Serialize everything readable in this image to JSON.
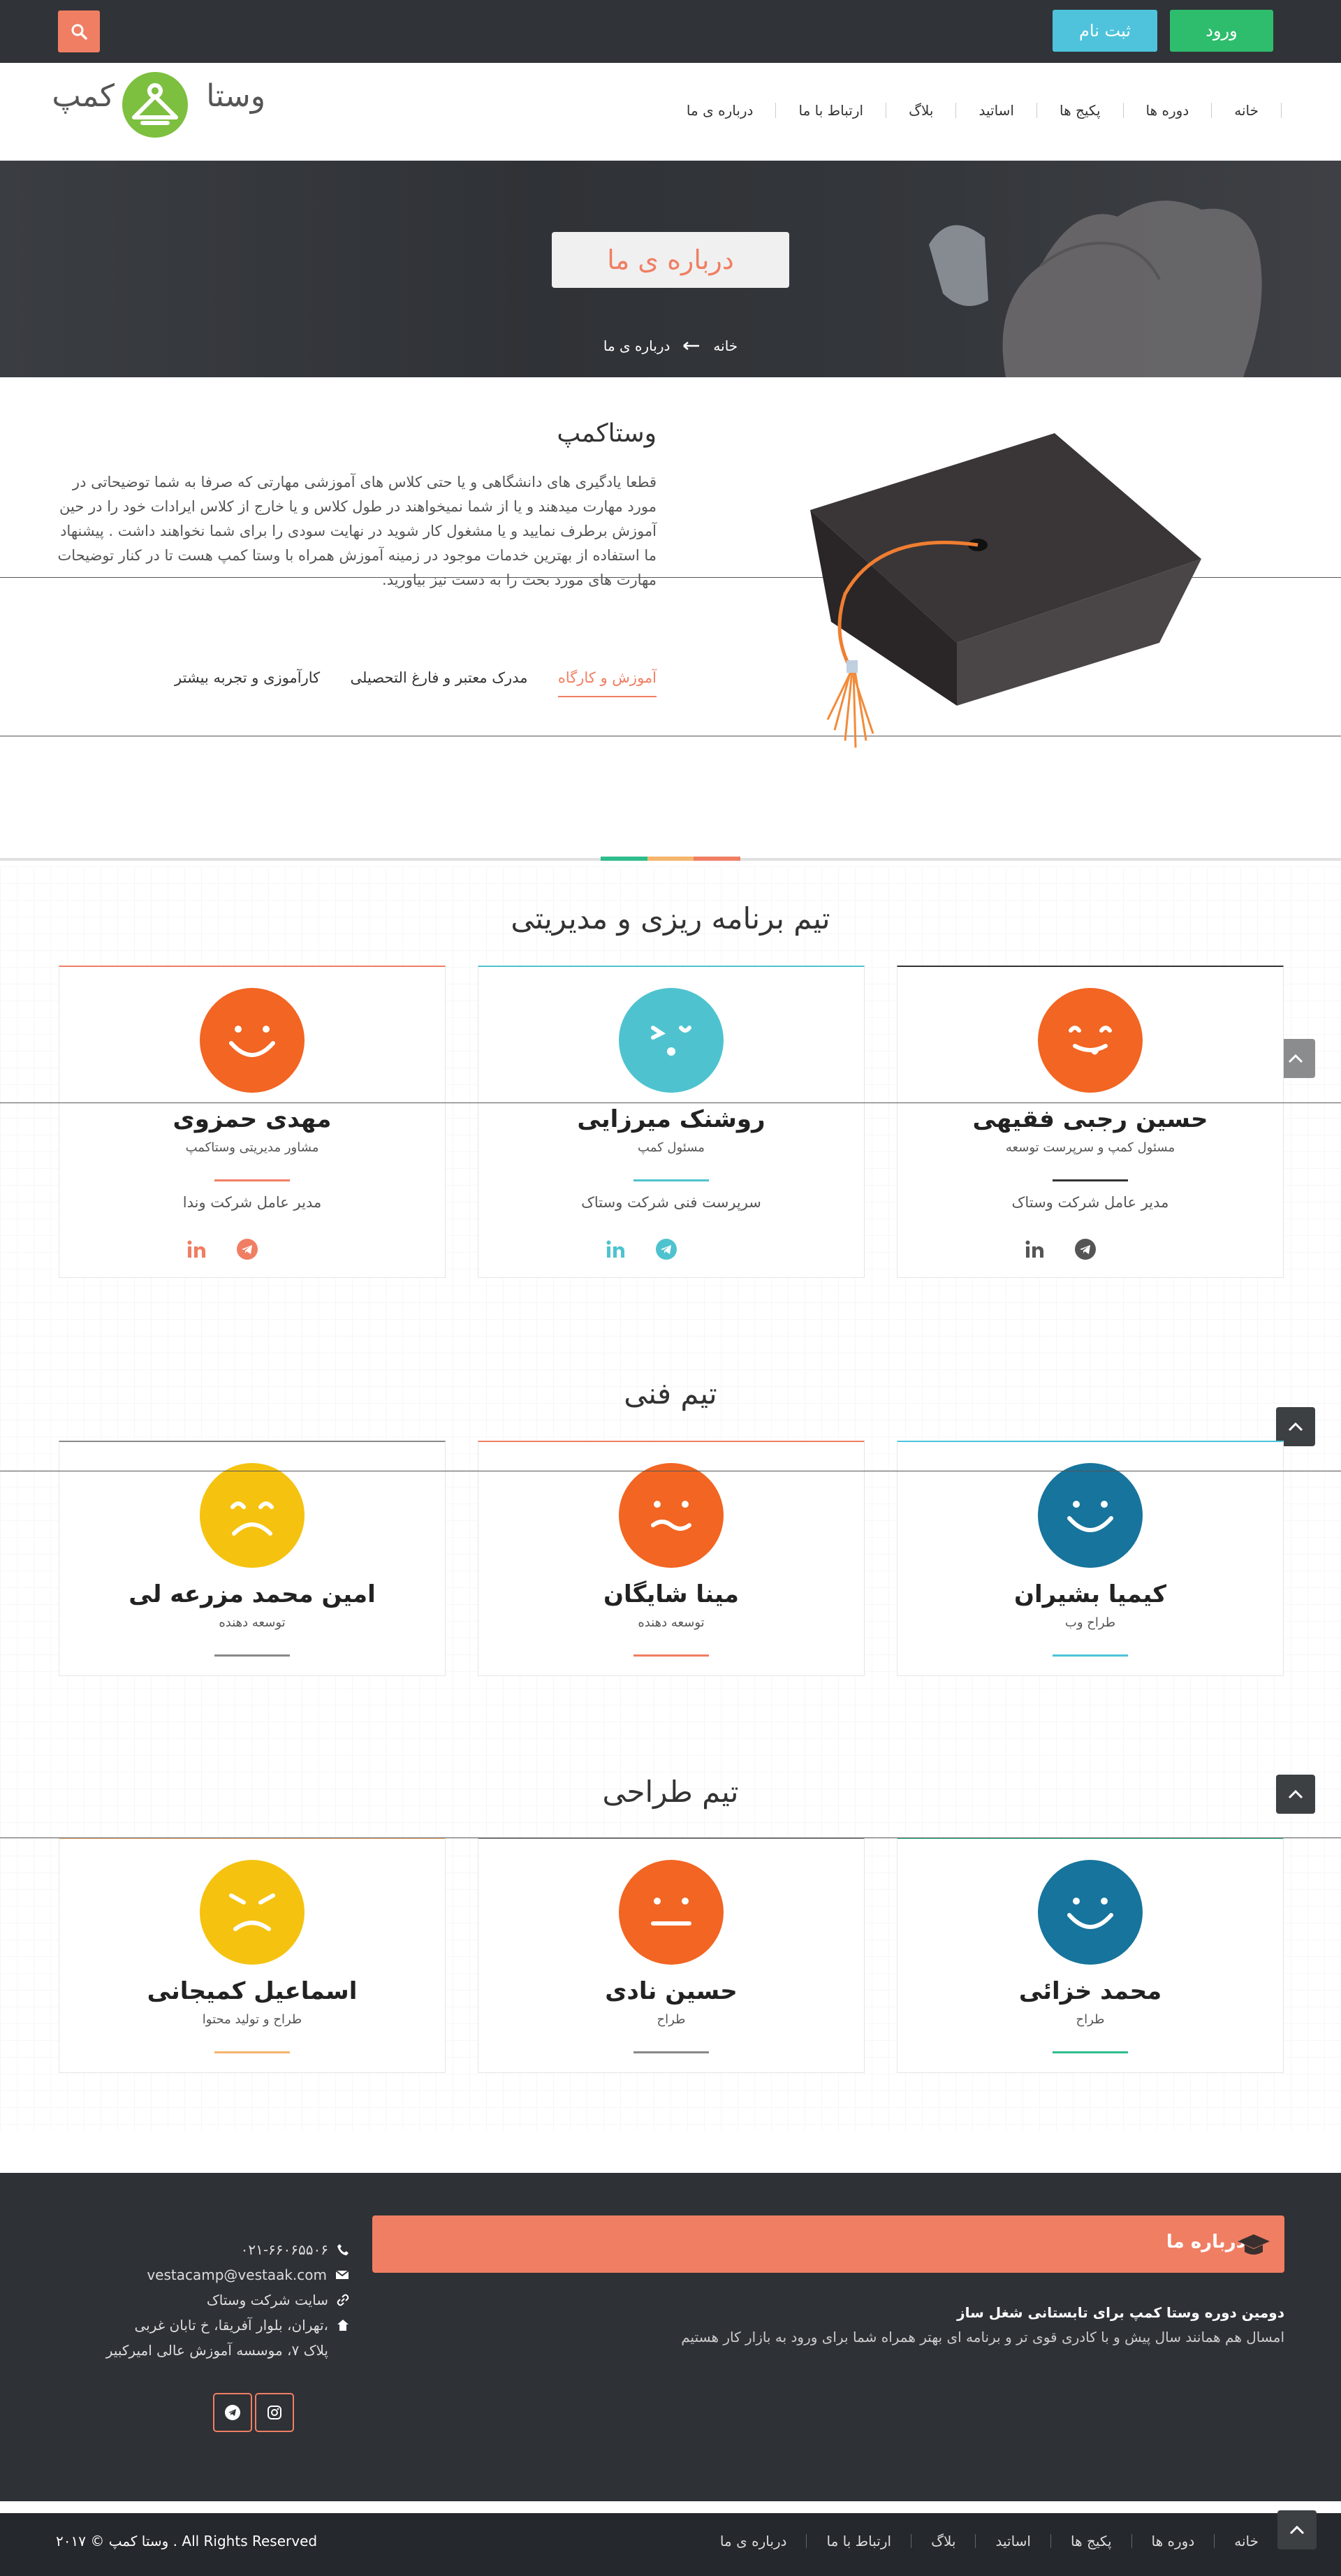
{
  "topbar": {
    "login": "ورود",
    "register": "ثبت نام"
  },
  "brand": {
    "name": "وستا کمپ"
  },
  "nav": {
    "items": [
      "خانه",
      "دوره ها",
      "پکیج ها",
      "اساتید",
      "بلاگ",
      "ارتباط با ما",
      "درباره ی ما"
    ]
  },
  "hero": {
    "title": "درباره ی ما",
    "breadcrumb_home": "خانه",
    "breadcrumb_current": "درباره ی ما"
  },
  "about": {
    "title": "وستاکمپ",
    "paragraph": "قطعا یادگیری های دانشگاهی و یا حتی کلاس های آموزشی مهارتی که صرفا به شما توضیحاتی در مورد مهارت میدهند و یا از شما نمیخواهند در طول کلاس و یا خارج از کلاس ایرادات خود را در حین آموزش برطرف نمایید و یا مشغول کار شوید در نهایت سودی را برای شما نخواهند داشت . پیشنهاد ما استفاده از بهترین خدمات موجود در زمینه آموزش همراه با وستا کمپ هست تا در کنار توضیحات مهارت های مورد بحث را به دست نیز بیاورید.",
    "tabs": [
      "آموزش و کارگاه",
      "مدرک معتبر و فارغ التحصیلی",
      "کارآموزی و تجربه بیشتر"
    ]
  },
  "teams": [
    {
      "title": "تیم برنامه ریزی و مدیریتی",
      "members": [
        {
          "name": "حسین رجبی فقیهی",
          "role": "مسئول کمپ و سرپرست توسعه",
          "company": "مدیر عامل شرکت وستاک",
          "color": "#f26522",
          "accent": "#333333"
        },
        {
          "name": "روشنک میرزایی",
          "role": "مسئول کمپ",
          "company": "سرپرست فنی شرکت وستاک",
          "color": "#4ec3cf",
          "accent": "#4ec3cf"
        },
        {
          "name": "مهدی حمزوی",
          "role": "مشاور مدیریتی وستاکمپ",
          "company": "مدیر عامل شرکت وندا",
          "color": "#f26522",
          "accent": "#f07e63"
        }
      ]
    },
    {
      "title": "تیم فنی",
      "members": [
        {
          "name": "کیمیا بشیران",
          "role": "طراح وب",
          "color": "#17749c",
          "accent": "#4ec3db"
        },
        {
          "name": "مینا شایگان",
          "role": "توسعه دهنده",
          "color": "#f26522",
          "accent": "#f07e63"
        },
        {
          "name": "امین محمد مزرعه لی",
          "role": "توسعه دهنده",
          "color": "#f5c20f",
          "accent": "#888888"
        }
      ]
    },
    {
      "title": "تیم طراحی",
      "members": [
        {
          "name": "محمد خزائی",
          "role": "طراح",
          "color": "#17749c",
          "accent": "#2ebd8d"
        },
        {
          "name": "حسین نادی",
          "role": "طراح",
          "color": "#f26522",
          "accent": "#888888"
        },
        {
          "name": "اسماعیل کمیجانی",
          "role": "طراح و تولید محتوا",
          "color": "#f5c20f",
          "accent": "#f5b56c"
        }
      ]
    }
  ],
  "footer": {
    "about_title": "درباره ما",
    "headline": "دومین دوره وستا کمپ برای تابستانی شغل ساز",
    "text": "امسال هم همانند سال پیش و با کادری قوی تر و برنامه ای بهتر همراه شما برای ورود به بازار کار هستیم",
    "phone": "۰۲۱-۶۶۰۶۵۵۰۶",
    "email": "vestacamp@vestaak.com",
    "site": "سایت شرکت وستاک",
    "address1": "تهران، بلوار آفریقا، خ تابان غربی،",
    "address2": "پلاک ۷، موسسه آموزش عالی امیرکبیر",
    "nav": [
      "خانه",
      "دوره ها",
      "پکیج ها",
      "اساتید",
      "بلاگ",
      "ارتباط با ما",
      "درباره ی ما"
    ],
    "copyright": "۲۰۱۷ © وستا کمپ . All Rights Reserved"
  },
  "colors": {
    "brand_orange": "#f07e63",
    "brand_green": "#2ebd6d",
    "brand_cyan": "#4ec3db",
    "dark": "#303338"
  }
}
